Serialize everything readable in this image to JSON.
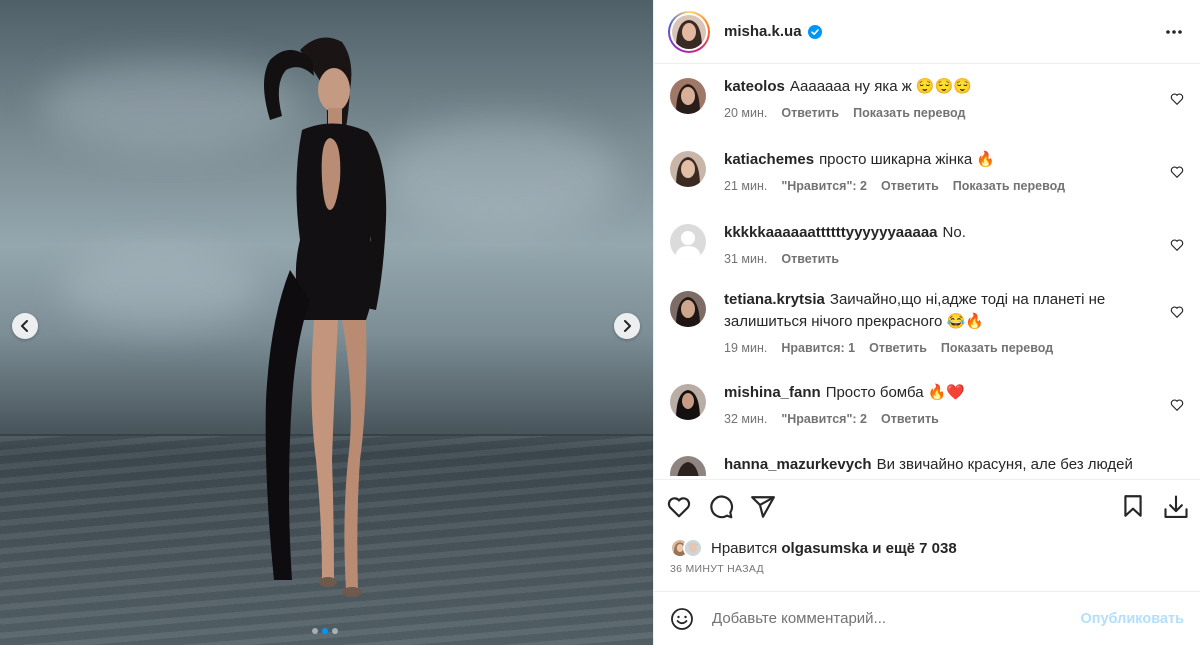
{
  "post": {
    "author": "misha.k.ua",
    "verified": true,
    "carousel": {
      "slide_count": 3,
      "current_slide": 1
    }
  },
  "comments": [
    {
      "user": "kateolos",
      "text": "Ааааааа ну яка ж 😌😌😌",
      "time": "20 мин.",
      "likes": "",
      "reply": "Ответить",
      "translate": "Показать перевод"
    },
    {
      "user": "katiachemes",
      "text": "просто шикарна жінка 🔥",
      "time": "21 мин.",
      "likes": "\"Нравится\": 2",
      "reply": "Ответить",
      "translate": "Показать перевод"
    },
    {
      "user": "kkkkkaaaaaattttttyyyyyyaaaaa",
      "text": "No.",
      "time": "31 мин.",
      "likes": "",
      "reply": "Ответить",
      "translate": ""
    },
    {
      "user": "tetiana.krytsia",
      "text": "Заичайно,що ні,адже тоді на планеті не залишиться нічого прекрасного 😂🔥",
      "time": "19 мин.",
      "likes": "Нравится: 1",
      "reply": "Ответить",
      "translate": "Показать перевод"
    },
    {
      "user": "mishina_fann",
      "text": "Просто бомба 🔥❤️",
      "time": "32 мин.",
      "likes": "\"Нравится\": 2",
      "reply": "Ответить",
      "translate": ""
    },
    {
      "user": "hanna_mazurkevych",
      "text": "Ви звичайно красуня, але без людей",
      "time": "",
      "likes": "",
      "reply": "",
      "translate": ""
    }
  ],
  "likes": {
    "prefix": "Нравится",
    "user": "olgasumska",
    "suffix": "и ещё 7 038"
  },
  "posted_time": "36 МИНУТ НАЗАД",
  "add_comment": {
    "placeholder": "Добавьте комментарий...",
    "publish_label": "Опубликовать"
  },
  "colors": {
    "accent": "#0095f6",
    "publish_disabled": "#b2dffc",
    "verified": "#0095f6",
    "muted": "#737373",
    "heart_red": "#ed4956"
  },
  "icons": [
    "chevron-left-icon",
    "chevron-right-icon",
    "verified-badge-icon",
    "more-icon",
    "heart-icon",
    "comment-icon",
    "share-icon",
    "bookmark-icon",
    "download-icon",
    "emoji-icon"
  ]
}
